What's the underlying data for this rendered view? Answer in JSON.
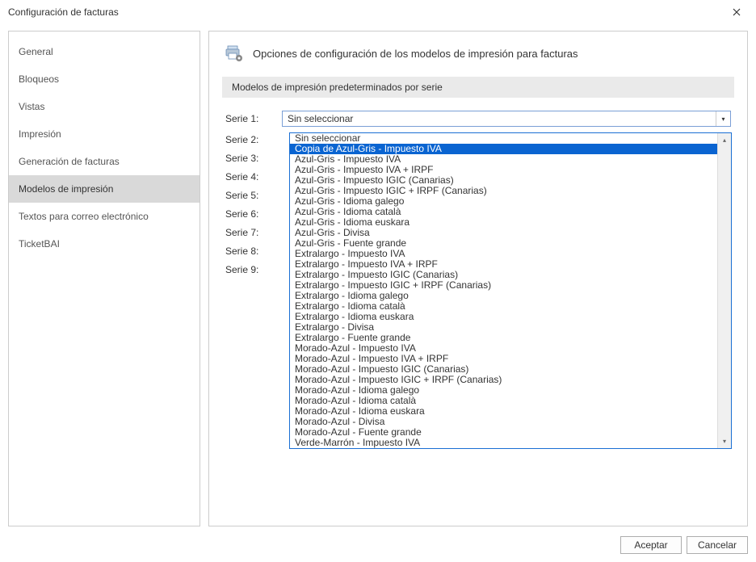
{
  "window": {
    "title": "Configuración de facturas"
  },
  "sidebar": {
    "items": [
      {
        "label": "General"
      },
      {
        "label": "Bloqueos"
      },
      {
        "label": "Vistas"
      },
      {
        "label": "Impresión"
      },
      {
        "label": "Generación de facturas"
      },
      {
        "label": "Modelos de impresión"
      },
      {
        "label": "Textos para correo electrónico"
      },
      {
        "label": "TicketBAI"
      }
    ],
    "selected_index": 5
  },
  "content": {
    "title": "Opciones de configuración de los modelos de impresión para facturas",
    "section_label": "Modelos de impresión predeterminados por serie",
    "series": [
      {
        "label": "Serie 1:",
        "value": "Sin seleccionar"
      },
      {
        "label": "Serie 2:",
        "value": ""
      },
      {
        "label": "Serie 3:",
        "value": ""
      },
      {
        "label": "Serie 4:",
        "value": ""
      },
      {
        "label": "Serie 5:",
        "value": ""
      },
      {
        "label": "Serie 6:",
        "value": ""
      },
      {
        "label": "Serie 7:",
        "value": ""
      },
      {
        "label": "Serie 8:",
        "value": ""
      },
      {
        "label": "Serie 9:",
        "value": ""
      }
    ]
  },
  "dropdown": {
    "highlighted_index": 1,
    "options": [
      "Sin seleccionar",
      "Copia de Azul-Gris - Impuesto IVA",
      "Azul-Gris - Impuesto IVA",
      "Azul-Gris - Impuesto IVA + IRPF",
      "Azul-Gris - Impuesto IGIC (Canarias)",
      "Azul-Gris - Impuesto IGIC + IRPF (Canarias)",
      "Azul-Gris - Idioma galego",
      "Azul-Gris - Idioma català",
      "Azul-Gris - Idioma euskara",
      "Azul-Gris - Divisa",
      "Azul-Gris - Fuente grande",
      "Extralargo - Impuesto IVA",
      "Extralargo - Impuesto IVA + IRPF",
      "Extralargo - Impuesto IGIC (Canarias)",
      "Extralargo - Impuesto IGIC + IRPF (Canarias)",
      "Extralargo - Idioma galego",
      "Extralargo - Idioma català",
      "Extralargo - Idioma euskara",
      "Extralargo - Divisa",
      "Extralargo - Fuente grande",
      "Morado-Azul - Impuesto IVA",
      "Morado-Azul - Impuesto IVA + IRPF",
      "Morado-Azul - Impuesto IGIC (Canarias)",
      "Morado-Azul - Impuesto IGIC + IRPF (Canarias)",
      "Morado-Azul - Idioma galego",
      "Morado-Azul - Idioma català",
      "Morado-Azul - Idioma euskara",
      "Morado-Azul - Divisa",
      "Morado-Azul - Fuente grande",
      "Verde-Marrón - Impuesto IVA"
    ]
  },
  "footer": {
    "accept": "Aceptar",
    "cancel": "Cancelar"
  }
}
